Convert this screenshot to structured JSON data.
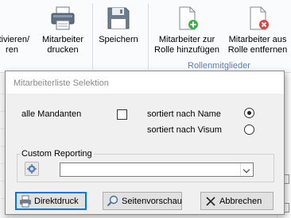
{
  "ribbon": {
    "btn_partial_line1": "ktivieren/",
    "btn_partial_line2": "ren",
    "btn_print_line1": "Mitarbeiter",
    "btn_print_line2": "drucken",
    "btn_save": "Speichern",
    "btn_add_line1": "Mitarbeiter zur",
    "btn_add_line2": "Rolle hinzufügen",
    "btn_remove_line1": "Mitarbeiter aus",
    "btn_remove_line2": "Rolle entfernen",
    "group_caption": "Rollenmitglieder"
  },
  "dialog": {
    "title": "Mitarbeiterliste Selektion",
    "all_clients_label": "alle Mandanten",
    "all_clients_checked": false,
    "sort_name_label": "sortiert nach Name",
    "sort_name_checked": true,
    "sort_visum_label": "sortiert nach Visum",
    "sort_visum_checked": false,
    "custom_reporting_legend": "Custom Reporting",
    "custom_reporting_value": "",
    "btn_direct_print": "Direktdruck",
    "btn_preview": "Seitenvorschau",
    "btn_cancel": "Abbrechen"
  },
  "colors": {
    "accent": "#0078d7",
    "group_caption": "#5b7fb5",
    "title_text": "#8a8a8a"
  }
}
